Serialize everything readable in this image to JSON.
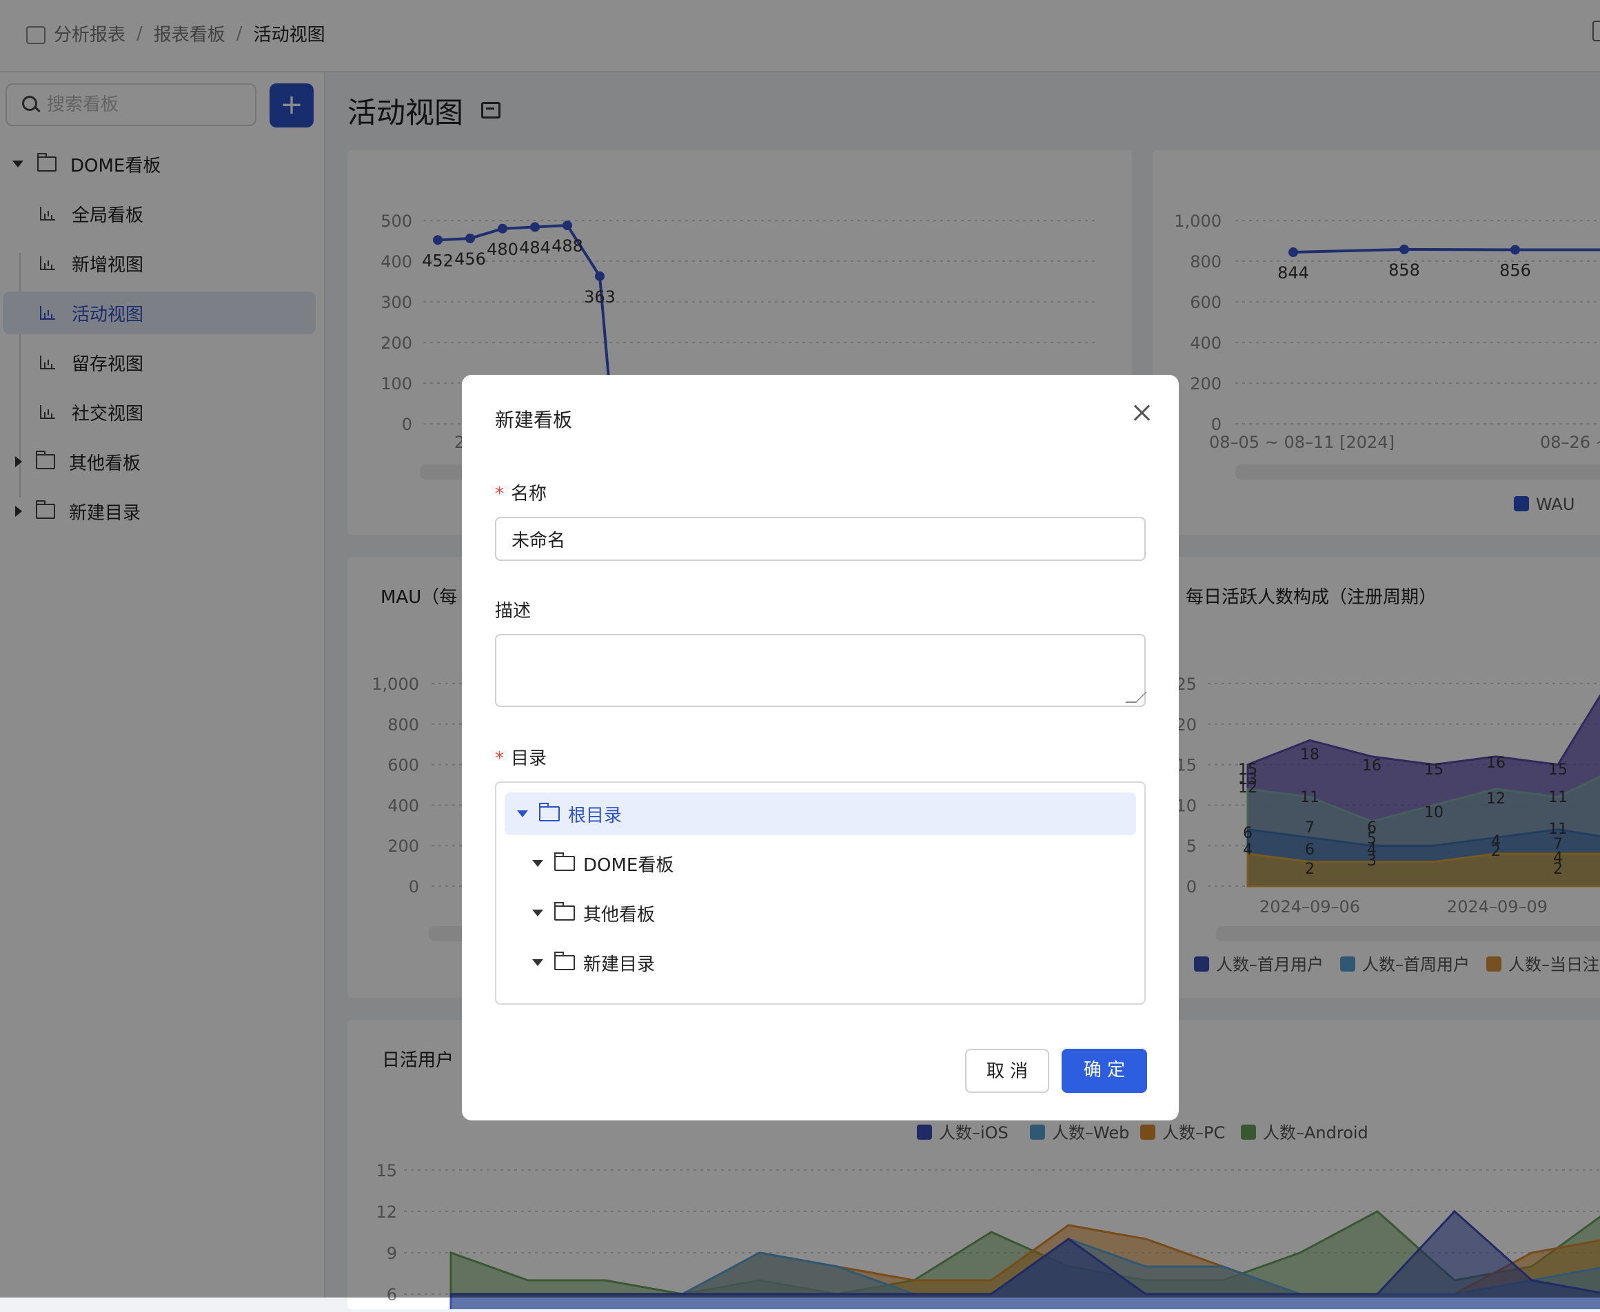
{
  "breadcrumb": {
    "items": [
      "分析报表",
      "报表看板",
      "活动视图"
    ]
  },
  "sidebar": {
    "search_placeholder": "搜索看板",
    "add_label": "+",
    "tree": [
      {
        "label": "DOME看板"
      },
      {
        "label": "全局看板"
      },
      {
        "label": "新增视图"
      },
      {
        "label": "活动视图"
      },
      {
        "label": "留存视图"
      },
      {
        "label": "社交视图"
      },
      {
        "label": "其他看板"
      },
      {
        "label": "新建目录"
      }
    ]
  },
  "page": {
    "title": "活动视图"
  },
  "cards": {
    "mau_title": "MAU（每",
    "composition_title": "每日活跃人数构成（注册周期）",
    "dau_title": "日活用户"
  },
  "colors": {
    "accent": "#2d52c8",
    "primary_button": "#2d5ee0",
    "line": "#3a55c8"
  },
  "chart_data": [
    {
      "type": "line",
      "y_ticks": [
        "500",
        "400",
        "300",
        "200",
        "100",
        "0"
      ],
      "x_tick_partial": "2",
      "ylim": [
        0,
        500
      ],
      "values": [
        452,
        456,
        480,
        484,
        488,
        363
      ],
      "labels": [
        "452",
        "456",
        "480",
        "484",
        "488",
        "363"
      ]
    },
    {
      "type": "line",
      "y_ticks": [
        "1,000",
        "800",
        "600",
        "400",
        "200",
        "0"
      ],
      "x_ticks": [
        "08–05 ~ 08–11 [2024]",
        "08–26 ~"
      ],
      "ylim": [
        0,
        1000
      ],
      "values": [
        844,
        858,
        856
      ],
      "labels": [
        "844",
        "858",
        "856"
      ],
      "legend": [
        "WAU"
      ]
    },
    {
      "type": "line",
      "y_ticks": [
        "1,000",
        "800",
        "600",
        "400",
        "200",
        "0"
      ],
      "ylim": [
        0,
        1000
      ]
    },
    {
      "type": "area",
      "y_ticks": [
        "25",
        "20",
        "15",
        "10",
        "5",
        "0"
      ],
      "x_ticks": [
        "2024–09–06",
        "2024–09–09"
      ],
      "ylim": [
        0,
        25
      ],
      "legend": [
        "人数–首月用户",
        "人数–首周用户",
        "人数–当日注"
      ],
      "labels_visible": [
        "18",
        "16",
        "15",
        "16",
        "15",
        "15",
        "13",
        "12",
        "11",
        "10",
        "12",
        "11",
        "11",
        "7",
        "6",
        "4",
        "6",
        "4",
        "2",
        "5",
        "3",
        "6",
        "4",
        "2",
        "7",
        "4",
        "2"
      ]
    },
    {
      "type": "area",
      "y_ticks": [
        "15",
        "12",
        "9",
        "6"
      ],
      "ylim": [
        0,
        15
      ],
      "legend": [
        "人数–iOS",
        "人数–Web",
        "人数–PC",
        "人数–Android"
      ]
    }
  ],
  "modal": {
    "title": "新建看板",
    "name_label": "名称",
    "name_value": "未命名",
    "desc_label": "描述",
    "dir_label": "目录",
    "dir_tree": [
      "根目录",
      "DOME看板",
      "其他看板",
      "新建目录"
    ],
    "cancel_label": "取 消",
    "ok_label": "确 定"
  }
}
